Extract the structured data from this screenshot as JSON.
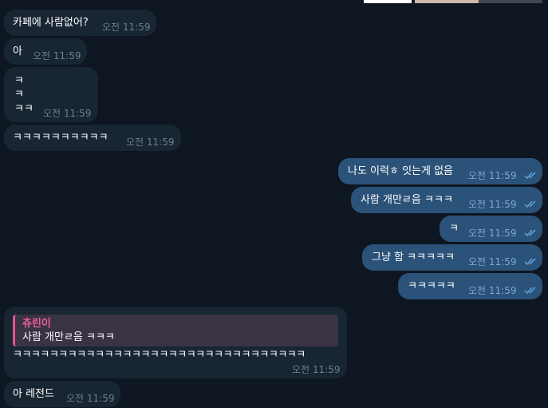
{
  "colors": {
    "background": "#0e1621",
    "incoming_bubble": "#182533",
    "outgoing_bubble": "#2b5278",
    "incoming_time": "#6d7f8f",
    "outgoing_time": "#7da8d3",
    "read_checks": "#5fa8e6",
    "quote_accent": "#e0558a"
  },
  "media_preview": {
    "icon": "image-thumbnail-strip"
  },
  "messages": [
    {
      "direction": "in",
      "text": "카페에 사람없어?",
      "time": "오전 11:59"
    },
    {
      "direction": "in",
      "text": "아",
      "time": "오전 11:59"
    },
    {
      "direction": "in",
      "lines": [
        "ㅋ",
        "ㅋ",
        "ㅋㅋ"
      ],
      "time": "오전 11:59"
    },
    {
      "direction": "in",
      "text": "ㅋㅋㅋㅋㅋㅋㅋㅋㅋㅋ",
      "time": "오전 11:59"
    },
    {
      "direction": "out",
      "text": "나도 이럭ㅎ 잇는게 없음",
      "time": "오전 11:59",
      "status": "read"
    },
    {
      "direction": "out",
      "text": "사람 개만ㄹ음 ㅋㅋㅋ",
      "time": "오전 11:59",
      "status": "read"
    },
    {
      "direction": "out",
      "text": "ㅋ",
      "time": "오전 11:59",
      "status": "read"
    },
    {
      "direction": "out",
      "text": "그냥 함 ㅋㅋㅋㅋㅋ",
      "time": "오전 11:59",
      "status": "read"
    },
    {
      "direction": "out",
      "text": "ㅋㅋㅋㅋㅋ",
      "time": "오전 11:59",
      "status": "read"
    },
    {
      "direction": "in",
      "reply_to": {
        "author": "츄린이",
        "text": "사람 개만ㄹ음 ㅋㅋㅋ"
      },
      "text": "ㅋㅋㅋㅋㅋㅋㅋㅋㅋㅋㅋㅋㅋㅋㅋㅋㅋㅋㅋㅋㅋㅋㅋㅋㅋㅋㅋㅋㅋㅋㅋㅋ",
      "time": "오전 11:59"
    },
    {
      "direction": "in",
      "text": "아 레전드",
      "time": "오전 11:59"
    }
  ]
}
